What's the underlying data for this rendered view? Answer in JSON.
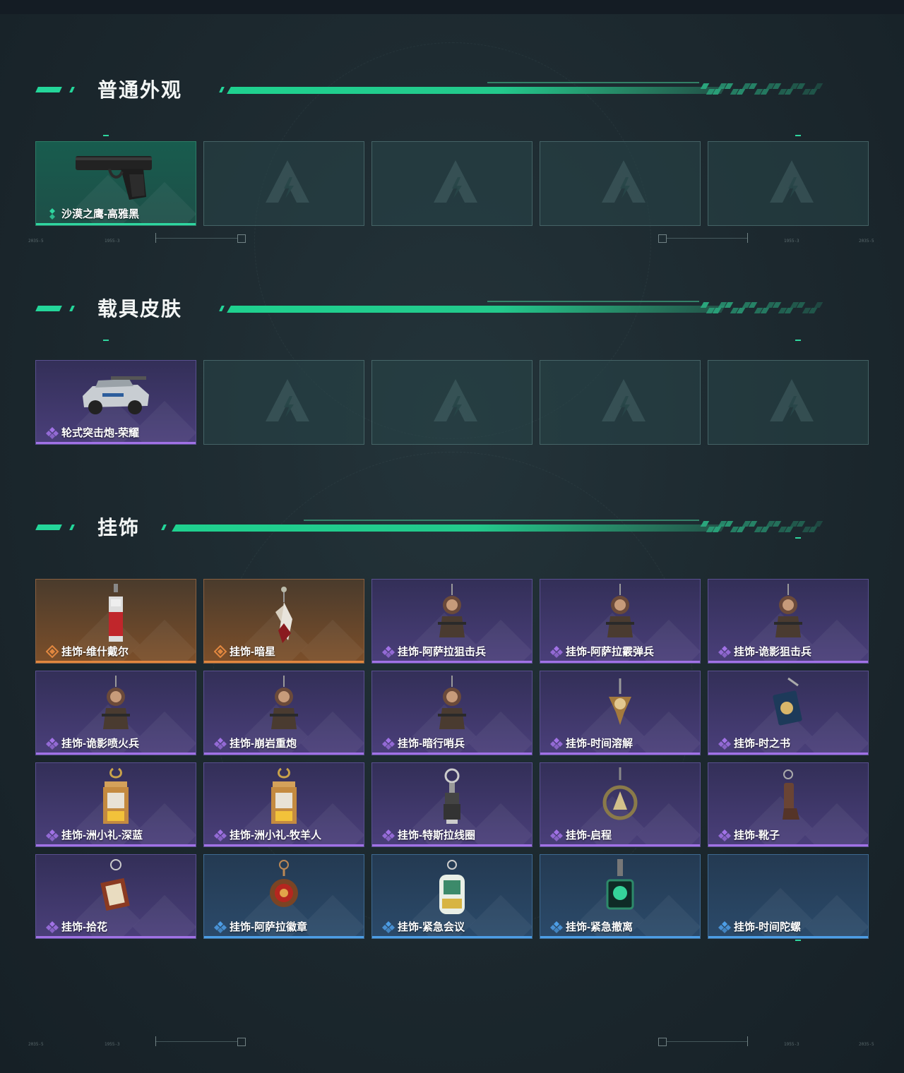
{
  "sections": [
    {
      "title": "普通外观",
      "items": [
        {
          "name": "沙漠之鹰-高雅黑",
          "rarity": "green",
          "icon": "pistol-icon"
        },
        {
          "name": "",
          "rarity": "empty"
        },
        {
          "name": "",
          "rarity": "empty"
        },
        {
          "name": "",
          "rarity": "empty"
        },
        {
          "name": "",
          "rarity": "empty"
        }
      ]
    },
    {
      "title": "载具皮肤",
      "items": [
        {
          "name": "轮式突击炮-荣耀",
          "rarity": "purple",
          "icon": "vehicle-icon"
        },
        {
          "name": "",
          "rarity": "empty"
        },
        {
          "name": "",
          "rarity": "empty"
        },
        {
          "name": "",
          "rarity": "empty"
        },
        {
          "name": "",
          "rarity": "empty"
        }
      ]
    },
    {
      "title": "挂饰",
      "items": [
        {
          "name": "挂饰-维什戴尔",
          "rarity": "orange",
          "icon": "charm-tag-icon"
        },
        {
          "name": "挂饰-暗星",
          "rarity": "orange",
          "icon": "charm-feather-icon"
        },
        {
          "name": "挂饰-阿萨拉狙击兵",
          "rarity": "purple",
          "icon": "charm-figure-icon"
        },
        {
          "name": "挂饰-阿萨拉霰弹兵",
          "rarity": "purple",
          "icon": "charm-figure-icon"
        },
        {
          "name": "挂饰-诡影狙击兵",
          "rarity": "purple",
          "icon": "charm-figure-icon"
        },
        {
          "name": "挂饰-诡影喷火兵",
          "rarity": "purple",
          "icon": "charm-figure-icon"
        },
        {
          "name": "挂饰-崩岩重炮",
          "rarity": "purple",
          "icon": "charm-figure-icon"
        },
        {
          "name": "挂饰-暗行哨兵",
          "rarity": "purple",
          "icon": "charm-figure-icon"
        },
        {
          "name": "挂饰-时间溶解",
          "rarity": "purple",
          "icon": "charm-clock-icon"
        },
        {
          "name": "挂饰-时之书",
          "rarity": "purple",
          "icon": "charm-book-icon"
        },
        {
          "name": "挂饰-洲小礼-深蓝",
          "rarity": "purple",
          "icon": "charm-box-icon"
        },
        {
          "name": "挂饰-洲小礼-牧羊人",
          "rarity": "purple",
          "icon": "charm-box-icon"
        },
        {
          "name": "挂饰-特斯拉线圈",
          "rarity": "purple",
          "icon": "charm-coil-icon"
        },
        {
          "name": "挂饰-启程",
          "rarity": "purple",
          "icon": "charm-ring-icon"
        },
        {
          "name": "挂饰-靴子",
          "rarity": "purple",
          "icon": "charm-boot-icon"
        },
        {
          "name": "挂饰-拾花",
          "rarity": "purple",
          "icon": "charm-frame-icon"
        },
        {
          "name": "挂饰-阿萨拉徽章",
          "rarity": "blue",
          "icon": "charm-badge-icon"
        },
        {
          "name": "挂饰-紧急会议",
          "rarity": "blue",
          "icon": "charm-sticker-icon"
        },
        {
          "name": "挂饰-紧急撤离",
          "rarity": "blue",
          "icon": "charm-square-icon"
        },
        {
          "name": "挂饰-时间陀螺",
          "rarity": "blue",
          "icon": ""
        }
      ]
    }
  ],
  "rarity_colors": {
    "green": "#2fd6a0",
    "purple": "#a172e6",
    "orange": "#e1873f",
    "blue": "#4d9ee6"
  },
  "ruler_text": {
    "left": "2035-5",
    "mid_left": "1955-3",
    "mid_right": "1955-3",
    "right": "2035-5"
  }
}
